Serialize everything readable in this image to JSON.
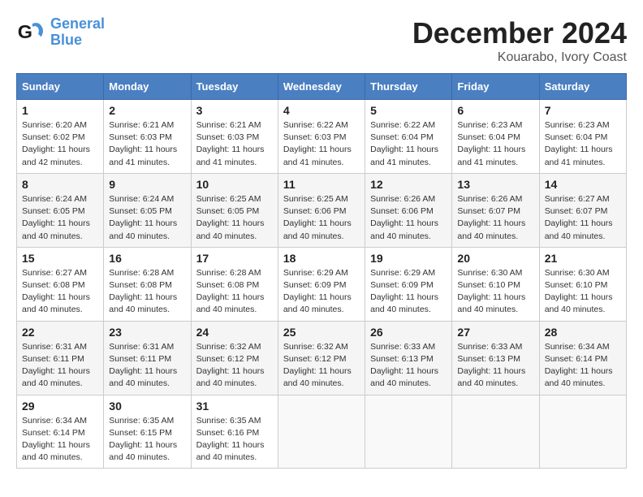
{
  "logo": {
    "line1": "General",
    "line2": "Blue"
  },
  "title": "December 2024",
  "location": "Kouarabo, Ivory Coast",
  "days_of_week": [
    "Sunday",
    "Monday",
    "Tuesday",
    "Wednesday",
    "Thursday",
    "Friday",
    "Saturday"
  ],
  "weeks": [
    [
      {
        "day": "1",
        "sunrise": "6:20 AM",
        "sunset": "6:02 PM",
        "daylight": "11 hours and 42 minutes."
      },
      {
        "day": "2",
        "sunrise": "6:21 AM",
        "sunset": "6:03 PM",
        "daylight": "11 hours and 41 minutes."
      },
      {
        "day": "3",
        "sunrise": "6:21 AM",
        "sunset": "6:03 PM",
        "daylight": "11 hours and 41 minutes."
      },
      {
        "day": "4",
        "sunrise": "6:22 AM",
        "sunset": "6:03 PM",
        "daylight": "11 hours and 41 minutes."
      },
      {
        "day": "5",
        "sunrise": "6:22 AM",
        "sunset": "6:04 PM",
        "daylight": "11 hours and 41 minutes."
      },
      {
        "day": "6",
        "sunrise": "6:23 AM",
        "sunset": "6:04 PM",
        "daylight": "11 hours and 41 minutes."
      },
      {
        "day": "7",
        "sunrise": "6:23 AM",
        "sunset": "6:04 PM",
        "daylight": "11 hours and 41 minutes."
      }
    ],
    [
      {
        "day": "8",
        "sunrise": "6:24 AM",
        "sunset": "6:05 PM",
        "daylight": "11 hours and 40 minutes."
      },
      {
        "day": "9",
        "sunrise": "6:24 AM",
        "sunset": "6:05 PM",
        "daylight": "11 hours and 40 minutes."
      },
      {
        "day": "10",
        "sunrise": "6:25 AM",
        "sunset": "6:05 PM",
        "daylight": "11 hours and 40 minutes."
      },
      {
        "day": "11",
        "sunrise": "6:25 AM",
        "sunset": "6:06 PM",
        "daylight": "11 hours and 40 minutes."
      },
      {
        "day": "12",
        "sunrise": "6:26 AM",
        "sunset": "6:06 PM",
        "daylight": "11 hours and 40 minutes."
      },
      {
        "day": "13",
        "sunrise": "6:26 AM",
        "sunset": "6:07 PM",
        "daylight": "11 hours and 40 minutes."
      },
      {
        "day": "14",
        "sunrise": "6:27 AM",
        "sunset": "6:07 PM",
        "daylight": "11 hours and 40 minutes."
      }
    ],
    [
      {
        "day": "15",
        "sunrise": "6:27 AM",
        "sunset": "6:08 PM",
        "daylight": "11 hours and 40 minutes."
      },
      {
        "day": "16",
        "sunrise": "6:28 AM",
        "sunset": "6:08 PM",
        "daylight": "11 hours and 40 minutes."
      },
      {
        "day": "17",
        "sunrise": "6:28 AM",
        "sunset": "6:08 PM",
        "daylight": "11 hours and 40 minutes."
      },
      {
        "day": "18",
        "sunrise": "6:29 AM",
        "sunset": "6:09 PM",
        "daylight": "11 hours and 40 minutes."
      },
      {
        "day": "19",
        "sunrise": "6:29 AM",
        "sunset": "6:09 PM",
        "daylight": "11 hours and 40 minutes."
      },
      {
        "day": "20",
        "sunrise": "6:30 AM",
        "sunset": "6:10 PM",
        "daylight": "11 hours and 40 minutes."
      },
      {
        "day": "21",
        "sunrise": "6:30 AM",
        "sunset": "6:10 PM",
        "daylight": "11 hours and 40 minutes."
      }
    ],
    [
      {
        "day": "22",
        "sunrise": "6:31 AM",
        "sunset": "6:11 PM",
        "daylight": "11 hours and 40 minutes."
      },
      {
        "day": "23",
        "sunrise": "6:31 AM",
        "sunset": "6:11 PM",
        "daylight": "11 hours and 40 minutes."
      },
      {
        "day": "24",
        "sunrise": "6:32 AM",
        "sunset": "6:12 PM",
        "daylight": "11 hours and 40 minutes."
      },
      {
        "day": "25",
        "sunrise": "6:32 AM",
        "sunset": "6:12 PM",
        "daylight": "11 hours and 40 minutes."
      },
      {
        "day": "26",
        "sunrise": "6:33 AM",
        "sunset": "6:13 PM",
        "daylight": "11 hours and 40 minutes."
      },
      {
        "day": "27",
        "sunrise": "6:33 AM",
        "sunset": "6:13 PM",
        "daylight": "11 hours and 40 minutes."
      },
      {
        "day": "28",
        "sunrise": "6:34 AM",
        "sunset": "6:14 PM",
        "daylight": "11 hours and 40 minutes."
      }
    ],
    [
      {
        "day": "29",
        "sunrise": "6:34 AM",
        "sunset": "6:14 PM",
        "daylight": "11 hours and 40 minutes."
      },
      {
        "day": "30",
        "sunrise": "6:35 AM",
        "sunset": "6:15 PM",
        "daylight": "11 hours and 40 minutes."
      },
      {
        "day": "31",
        "sunrise": "6:35 AM",
        "sunset": "6:16 PM",
        "daylight": "11 hours and 40 minutes."
      },
      null,
      null,
      null,
      null
    ]
  ]
}
